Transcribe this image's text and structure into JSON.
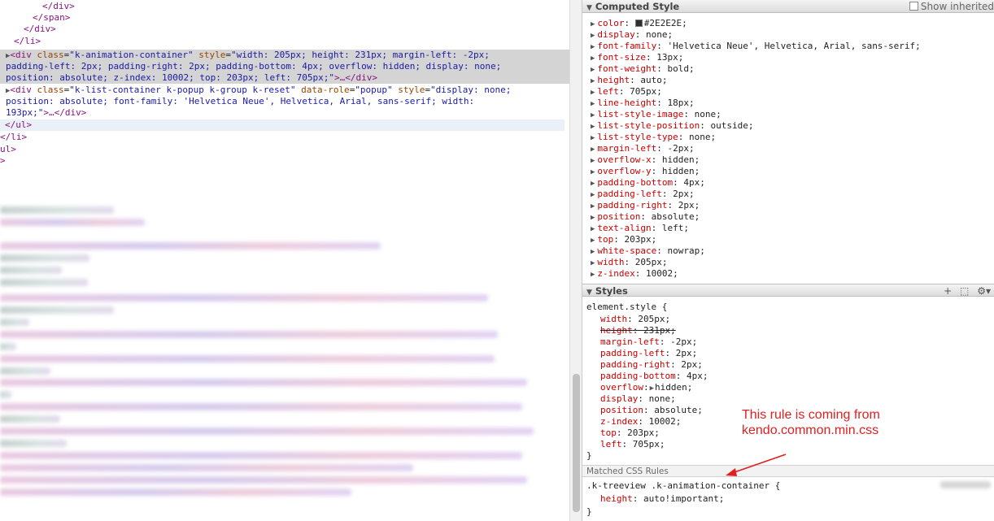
{
  "elements": {
    "l1": "</div>",
    "l2": "</span>",
    "l3": "</div>",
    "l4": "</li>",
    "sel": {
      "open": "<div",
      "class_attr": "class",
      "class_val": "\"k-animation-container\"",
      "style_attr": "style",
      "style_1": "\"width: 205px; height: 231px; margin-left: -2px;",
      "style_2": "padding-left: 2px; padding-right: 2px; padding-bottom: 4px; overflow: hidden; display: none;",
      "style_3": "position: absolute; z-index: 10002; top: 203px; left: 705px;\"",
      "close": ">…</div>"
    },
    "next": {
      "open": "<div",
      "class_attr": "class",
      "class_val": "\"k-list-container k-popup k-group k-reset\"",
      "role_attr": "data-role",
      "role_val": "\"popup\"",
      "style_attr": "style",
      "style_1": "\"display: none;",
      "style_2": "position: absolute; font-family: 'Helvetica Neue', Helvetica, Arial, sans-serif; width:",
      "style_3": "193px;\"",
      "close": ">…</div>"
    },
    "ul_close": "</ul>",
    "li_close": "</li>",
    "frag_ul": "ul>",
    "frag_gt": ">"
  },
  "computed": {
    "title": "Computed Style",
    "show_inherited": "Show inherited",
    "color_name": "color",
    "color_value": "#2E2E2E",
    "swatch_color": "#2E2E2E",
    "props": [
      {
        "n": "display",
        "v": "none"
      },
      {
        "n": "font-family",
        "v": "'Helvetica Neue', Helvetica, Arial, sans-serif"
      },
      {
        "n": "font-size",
        "v": "13px"
      },
      {
        "n": "font-weight",
        "v": "bold"
      },
      {
        "n": "height",
        "v": "auto"
      },
      {
        "n": "left",
        "v": "705px"
      },
      {
        "n": "line-height",
        "v": "18px"
      },
      {
        "n": "list-style-image",
        "v": "none"
      },
      {
        "n": "list-style-position",
        "v": "outside"
      },
      {
        "n": "list-style-type",
        "v": "none"
      },
      {
        "n": "margin-left",
        "v": "-2px"
      },
      {
        "n": "overflow-x",
        "v": "hidden"
      },
      {
        "n": "overflow-y",
        "v": "hidden"
      },
      {
        "n": "padding-bottom",
        "v": "4px"
      },
      {
        "n": "padding-left",
        "v": "2px"
      },
      {
        "n": "padding-right",
        "v": "2px"
      },
      {
        "n": "position",
        "v": "absolute"
      },
      {
        "n": "text-align",
        "v": "left"
      },
      {
        "n": "top",
        "v": "203px"
      },
      {
        "n": "white-space",
        "v": "nowrap"
      },
      {
        "n": "width",
        "v": "205px"
      },
      {
        "n": "z-index",
        "v": "10002"
      }
    ]
  },
  "styles": {
    "title": "Styles",
    "selector": "element.style {",
    "props": [
      {
        "n": "width",
        "v": "205px"
      },
      {
        "n": "height",
        "v": "231px"
      },
      {
        "n": "margin-left",
        "v": "-2px"
      },
      {
        "n": "padding-left",
        "v": "2px"
      },
      {
        "n": "padding-right",
        "v": "2px"
      },
      {
        "n": "padding-bottom",
        "v": "4px"
      },
      {
        "n": "overflow",
        "v": "hidden"
      },
      {
        "n": "display",
        "v": "none"
      },
      {
        "n": "position",
        "v": "absolute"
      },
      {
        "n": "z-index",
        "v": "10002"
      },
      {
        "n": "top",
        "v": "203px"
      },
      {
        "n": "left",
        "v": "705px"
      }
    ],
    "close": "}"
  },
  "matched": {
    "title": "Matched CSS Rules",
    "selector": ".k-treeview .k-animation-container {",
    "prop_name": "height",
    "prop_value": "auto!important",
    "close": "}"
  },
  "annotation": {
    "line1": "This rule is coming from",
    "line2": "kendo.common.min.css",
    "color": "#E02020"
  }
}
